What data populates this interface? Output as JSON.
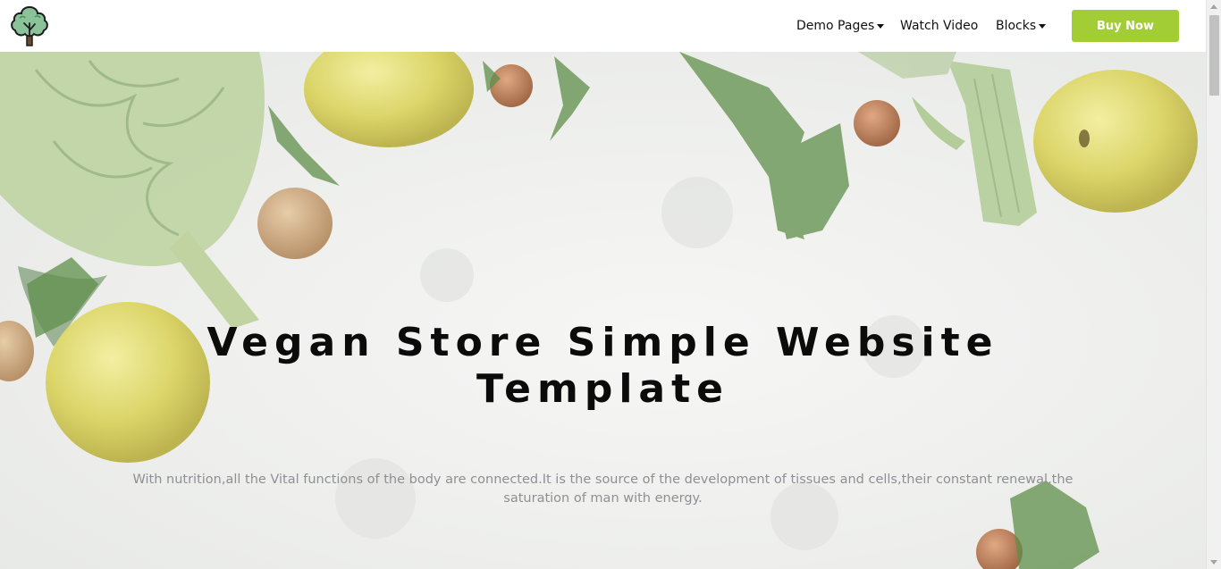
{
  "header": {
    "logo_icon": "tree-logo-icon",
    "nav": {
      "demo_pages": "Demo Pages",
      "watch_video": "Watch Video",
      "blocks": "Blocks"
    },
    "buy_now": "Buy Now"
  },
  "hero": {
    "title": "Vegan Store Simple Website Template",
    "description": "With nutrition,all the Vital functions of the body are connected.It is the source of the development of tissues and cells,their constant renewal,the saturation of man with energy."
  },
  "colors": {
    "accent": "#a3cd34",
    "title": "#0b0b0b",
    "description": "#8f8f94",
    "logo_green": "#4b8f5a",
    "logo_light": "#8cc29a"
  }
}
